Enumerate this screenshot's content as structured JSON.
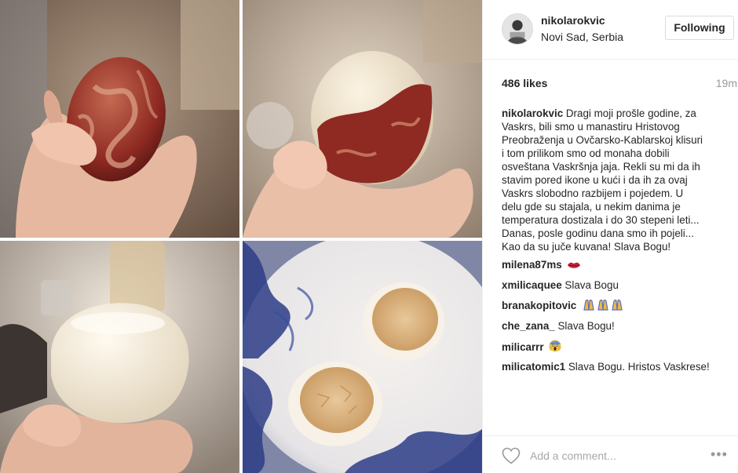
{
  "post": {
    "username": "nikolarokvic",
    "location": "Novi Sad, Serbia",
    "follow_label": "Following",
    "likes": "486 likes",
    "time_ago": "19m",
    "caption_lines": [
      "Dragi moji prošle godine, za",
      "Vaskrs, bili smo u manastiru Hristovog",
      "Preobraženja u Ovčarsko-Kablarskoj klisuri",
      "i tom prilikom smo od monaha dobili",
      "osveštana Vaskršnja jaja. Rekli su mi da ih",
      "stavim pored ikone u kući i da ih za ovaj",
      "Vaskrs slobodno razbijem i pojedem. U",
      "delu gde su stajala, u nekim danima je",
      "temperatura dostizala i do 30 stepeni leti...",
      "Danas, posle godinu dana smo ih pojeli...",
      "Kao da su juče kuvana! Slava Bogu!"
    ],
    "comments": [
      {
        "user": "milena87ms",
        "text": "",
        "emoji": "lips-emoji"
      },
      {
        "user": "xmilicaquee",
        "text": "Slava Bogu",
        "emoji": ""
      },
      {
        "user": "branakopitovic",
        "text": "",
        "emoji": "praying-hands-emoji"
      },
      {
        "user": "che_zana_",
        "text": "Slava Bogu!",
        "emoji": ""
      },
      {
        "user": "milicarrr",
        "text": "",
        "emoji": "screaming-face-emoji"
      },
      {
        "user": "milicatomic1",
        "text": "Slava Bogu. Hristos Vaskrese!",
        "emoji": ""
      }
    ],
    "add_comment_placeholder": "Add a comment...",
    "more_label": "•••"
  },
  "icons": {
    "like": "heart-icon",
    "options": "more-options-icon"
  },
  "colors": {
    "text": "#262626",
    "muted": "#999999",
    "border": "#efefef",
    "egg_red": "#8e2a22"
  }
}
